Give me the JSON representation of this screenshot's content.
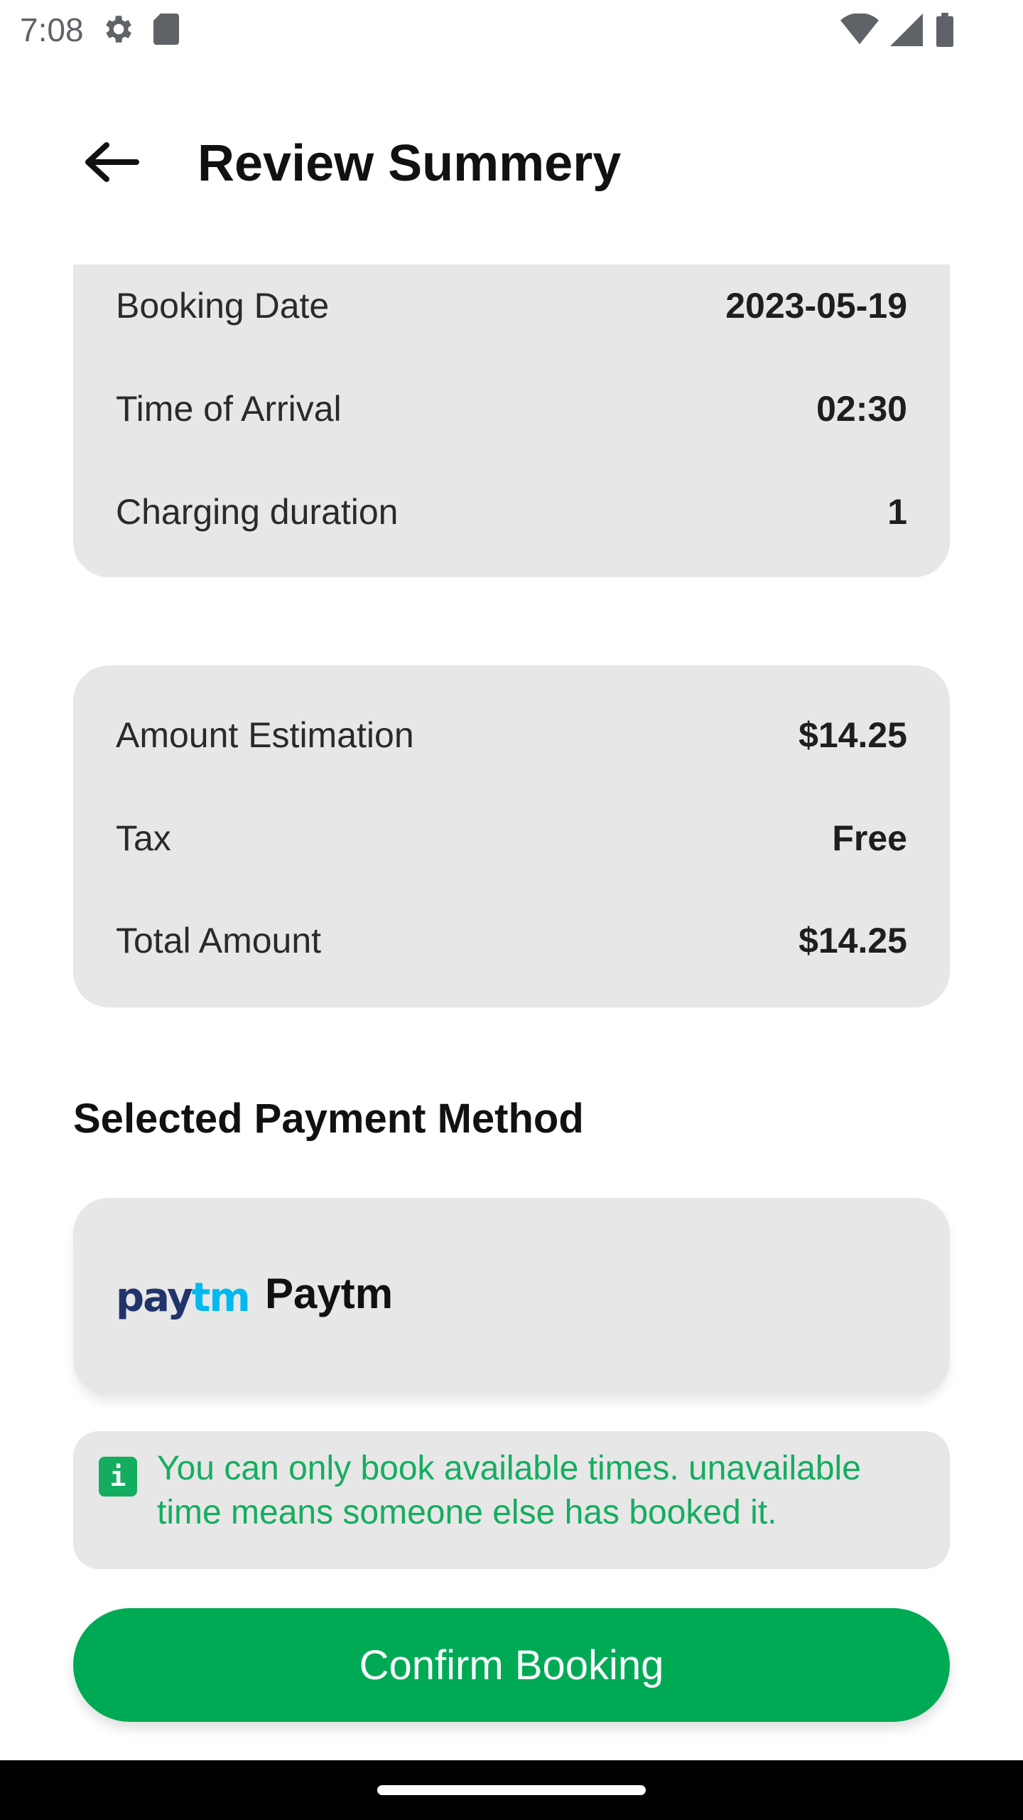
{
  "status_bar": {
    "time": "7:08",
    "left_icons": [
      "settings-icon",
      "sd-card-icon"
    ],
    "right_icons": [
      "wifi-icon",
      "signal-icon",
      "battery-icon"
    ]
  },
  "header": {
    "title": "Review Summery",
    "back_icon": "arrow-left-icon"
  },
  "booking_details": [
    {
      "label": "Booking Date",
      "value": "2023-05-19"
    },
    {
      "label": "Time of Arrival",
      "value": "02:30"
    },
    {
      "label": "Charging duration",
      "value": "1"
    }
  ],
  "amount_details": [
    {
      "label": "Amount Estimation",
      "value": "$14.25"
    },
    {
      "label": "Tax",
      "value": "Free"
    },
    {
      "label": "Total Amount",
      "value": "$14.25"
    }
  ],
  "payment": {
    "section_title": "Selected Payment Method",
    "logo_pay": "pay",
    "logo_tm": "tm",
    "method_name": "Paytm"
  },
  "info": {
    "icon_glyph": "i",
    "text": "You can only book available times. unavailable time means someone else has booked it."
  },
  "confirm_button": {
    "label": "Confirm Booking"
  },
  "colors": {
    "accent": "#00aa55",
    "card_bg": "#e7e7e7",
    "info_text": "#14ad5f",
    "paytm_dark": "#20336b",
    "paytm_light": "#00b9f1"
  }
}
